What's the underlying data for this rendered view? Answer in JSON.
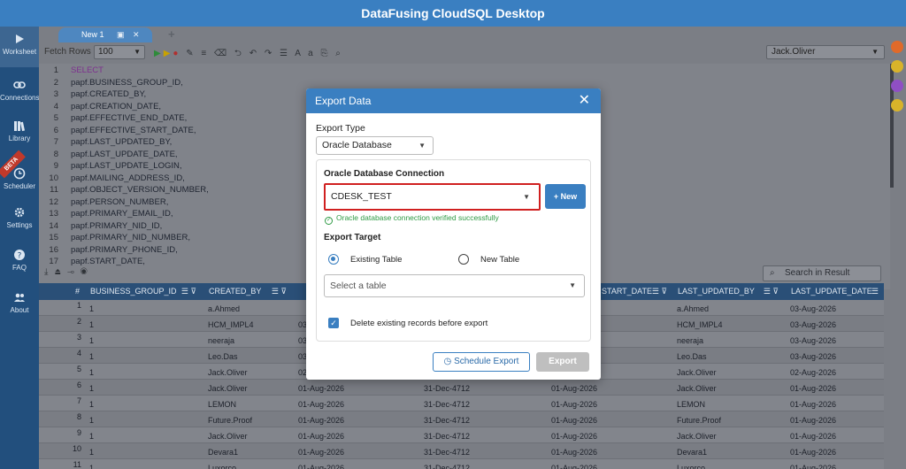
{
  "app": {
    "title": "DataFusing CloudSQL Desktop"
  },
  "nav": {
    "items": [
      {
        "label": "Worksheet",
        "icon": "play-icon"
      },
      {
        "label": "Connections",
        "icon": "link-icon"
      },
      {
        "label": "Library",
        "icon": "books-icon"
      },
      {
        "label": "Scheduler",
        "icon": "clock-icon"
      },
      {
        "label": "Settings",
        "icon": "gear-icon"
      },
      {
        "label": "FAQ",
        "icon": "question-icon"
      },
      {
        "label": "About",
        "icon": "users-icon"
      }
    ],
    "beta": "BETA"
  },
  "tabs": [
    {
      "label": "New 1"
    }
  ],
  "toolbar": {
    "fetch_label": "Fetch Rows",
    "fetch_value": "100",
    "user": "Jack.Oliver",
    "icons_text": "✎ ≡ ⌫ ⮌ ↶ ↷ ☰ A a ⎘ ⌕"
  },
  "editor": {
    "lines": [
      {
        "n": "1",
        "text": "SELECT"
      },
      {
        "n": "2",
        "text": "papf.BUSINESS_GROUP_ID,"
      },
      {
        "n": "3",
        "text": "papf.CREATED_BY,"
      },
      {
        "n": "4",
        "text": "papf.CREATION_DATE,"
      },
      {
        "n": "5",
        "text": "papf.EFFECTIVE_END_DATE,"
      },
      {
        "n": "6",
        "text": "papf.EFFECTIVE_START_DATE,"
      },
      {
        "n": "7",
        "text": "papf.LAST_UPDATED_BY,"
      },
      {
        "n": "8",
        "text": "papf.LAST_UPDATE_DATE,"
      },
      {
        "n": "9",
        "text": "papf.LAST_UPDATE_LOGIN,"
      },
      {
        "n": "10",
        "text": "papf.MAILING_ADDRESS_ID,"
      },
      {
        "n": "11",
        "text": "papf.OBJECT_VERSION_NUMBER,"
      },
      {
        "n": "12",
        "text": "papf.PERSON_NUMBER,"
      },
      {
        "n": "13",
        "text": "papf.PRIMARY_EMAIL_ID,"
      },
      {
        "n": "14",
        "text": "papf.PRIMARY_NID_ID,"
      },
      {
        "n": "15",
        "text": "papf.PRIMARY_NID_NUMBER,"
      },
      {
        "n": "16",
        "text": "papf.PRIMARY_PHONE_ID,"
      },
      {
        "n": "17",
        "text": "papf.START_DATE,"
      }
    ]
  },
  "results": {
    "search_placeholder": "Search in Result",
    "columns": [
      "#",
      "BUSINESS_GROUP_ID",
      "CREATED_BY",
      "",
      "",
      "START_DATE",
      "LAST_UPDATED_BY",
      "LAST_UPDATE_DATE"
    ],
    "rows": [
      {
        "n": "1",
        "bg": "1",
        "created_by": "a.Ahmed",
        "c3": "",
        "c4": "",
        "c5": "",
        "lub": "a.Ahmed",
        "lud": "03-Aug-2026"
      },
      {
        "n": "2",
        "bg": "1",
        "created_by": "HCM_IMPL4",
        "c3": "03",
        "c4": "",
        "c5": "",
        "lub": "HCM_IMPL4",
        "lud": "03-Aug-2026"
      },
      {
        "n": "3",
        "bg": "1",
        "created_by": "neeraja",
        "c3": "03",
        "c4": "",
        "c5": "",
        "lub": "neeraja",
        "lud": "03-Aug-2026"
      },
      {
        "n": "4",
        "bg": "1",
        "created_by": "Leo.Das",
        "c3": "03",
        "c4": "",
        "c5": "",
        "lub": "Leo.Das",
        "lud": "03-Aug-2026"
      },
      {
        "n": "5",
        "bg": "1",
        "created_by": "Jack.Oliver",
        "c3": "02",
        "c4": "",
        "c5": "",
        "lub": "Jack.Oliver",
        "lud": "02-Aug-2026"
      },
      {
        "n": "6",
        "bg": "1",
        "created_by": "Jack.Oliver",
        "c3": "01-Aug-2026",
        "c4": "31-Dec-4712",
        "c5": "01-Aug-2026",
        "lub": "Jack.Oliver",
        "lud": "01-Aug-2026"
      },
      {
        "n": "7",
        "bg": "1",
        "created_by": "LEMON",
        "c3": "01-Aug-2026",
        "c4": "31-Dec-4712",
        "c5": "01-Aug-2026",
        "lub": "LEMON",
        "lud": "01-Aug-2026"
      },
      {
        "n": "8",
        "bg": "1",
        "created_by": "Future.Proof",
        "c3": "01-Aug-2026",
        "c4": "31-Dec-4712",
        "c5": "01-Aug-2026",
        "lub": "Future.Proof",
        "lud": "01-Aug-2026"
      },
      {
        "n": "9",
        "bg": "1",
        "created_by": "Jack.Oliver",
        "c3": "01-Aug-2026",
        "c4": "31-Dec-4712",
        "c5": "01-Aug-2026",
        "lub": "Jack.Oliver",
        "lud": "01-Aug-2026"
      },
      {
        "n": "10",
        "bg": "1",
        "created_by": "Devara1",
        "c3": "01-Aug-2026",
        "c4": "31-Dec-4712",
        "c5": "01-Aug-2026",
        "lub": "Devara1",
        "lud": "01-Aug-2026"
      },
      {
        "n": "11",
        "bg": "1",
        "created_by": "Luxorco",
        "c3": "01-Aug-2026",
        "c4": "31-Dec-4712",
        "c5": "01-Aug-2026",
        "lub": "Luxorco",
        "lud": "01-Aug-2026"
      }
    ]
  },
  "modal": {
    "title": "Export Data",
    "export_type_label": "Export Type",
    "export_type_value": "Oracle Database",
    "connection_label": "Oracle Database Connection",
    "connection_value": "CDESK_TEST",
    "new_button": "+ New",
    "verify_message": "Oracle database connection verified successfully",
    "target_label": "Export Target",
    "option_existing": "Existing Table",
    "option_new": "New Table",
    "table_placeholder": "Select a table",
    "delete_existing_label": "Delete existing records before export",
    "delete_existing_checked": true,
    "schedule_button": "Schedule Export",
    "export_button": "Export"
  },
  "colors": {
    "accent": "#3a7fc1",
    "nav": "#224f7d",
    "success": "#2e9a44",
    "highlight": "#d02020"
  }
}
